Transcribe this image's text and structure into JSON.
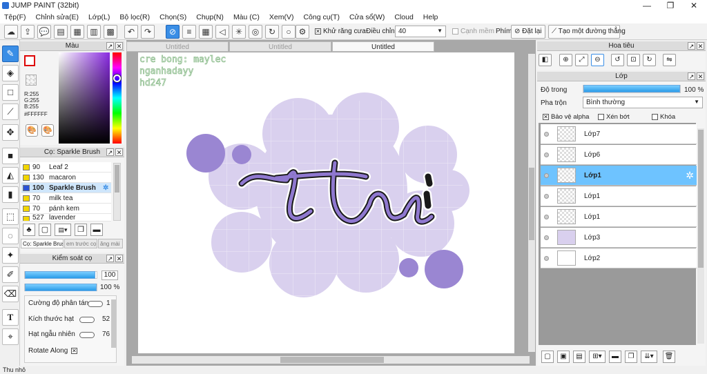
{
  "window": {
    "title": "JUMP PAINT (32bit)",
    "minimize": "—",
    "maximize": "❐",
    "close": "✕"
  },
  "menu": [
    "Tệp(F)",
    "Chỉnh sửa(E)",
    "Lớp(L)",
    "Bộ lọc(R)",
    "Chọn(S)",
    "Chụp(N)",
    "Màu (C)",
    "Xem(V)",
    "Công cụ(T)",
    "Cửa sổ(W)",
    "Cloud",
    "Help"
  ],
  "toolbar": {
    "antialias_label": "Khử răng cưa",
    "correction_label": "Điều chỉnh",
    "correction_value": "40",
    "edge_label": "Cạnh mềm",
    "key_label": "Phím",
    "reset_label": "Đặt lại",
    "straight_line_label": "Tạo một đường thẳng"
  },
  "color_panel": {
    "title": "Màu",
    "r": "R:255",
    "g": "G:255",
    "b": "B:255",
    "hex": "#FFFFFF"
  },
  "brush_panel": {
    "title": "Cọ: Sparkle Brush",
    "brushes": [
      {
        "size": "90",
        "name": "Leaf 2"
      },
      {
        "size": "130",
        "name": "macaron"
      },
      {
        "size": "100",
        "name": "Sparkle Brush"
      },
      {
        "size": "70",
        "name": "milk tea"
      },
      {
        "size": "70",
        "name": "pánh kem"
      },
      {
        "size": "527",
        "name": "lavender"
      }
    ],
    "tabs": [
      "Cọ: Sparkle Brush",
      "em trước cọ",
      "ăng mài"
    ]
  },
  "control_panel": {
    "title": "Kiểm soát cọ",
    "size_value": "100",
    "opacity_value": "100 %",
    "size_fill": 0.98,
    "opacity_fill": 1.0,
    "params": [
      {
        "label": "Cường độ phân tán",
        "value": "1"
      },
      {
        "label": "Kích thước hạt",
        "value": "52"
      },
      {
        "label": "Hạt ngẫu nhiên",
        "value": "76"
      },
      {
        "label": "Rotate Along",
        "value": "✕"
      }
    ]
  },
  "canvas": {
    "tabs": [
      "Untitled",
      "Untitled",
      "Untitled"
    ],
    "credit_lines": [
      "cre bong: maylec",
      "nganhadayy",
      "hd247"
    ],
    "lettering": "thai"
  },
  "navigator": {
    "title": "Hoa tiêu"
  },
  "layers": {
    "title": "Lớp",
    "opacity_label": "Độ trong",
    "opacity_value": "100 %",
    "opacity_fill": 1.0,
    "blend_label": "Pha trộn",
    "blend_value": "Bình thường",
    "protect_alpha_label": "Bảo vệ alpha",
    "clip_label": "Xén bớt",
    "lock_label": "Khóa",
    "list": [
      {
        "name": "Lớp7",
        "selected": false
      },
      {
        "name": "Lớp6",
        "selected": false
      },
      {
        "name": "Lớp1",
        "selected": true
      },
      {
        "name": "Lớp1",
        "selected": false
      },
      {
        "name": "Lớp1",
        "selected": false
      },
      {
        "name": "Lớp3",
        "selected": false
      },
      {
        "name": "Lớp2",
        "selected": false
      }
    ]
  },
  "status": {
    "text": "Thu nhỏ"
  },
  "colors": {
    "accent": "#3a8ee6",
    "selection": "#6ec3ff",
    "lavender": "#d9d0ee",
    "flower": "#9a86d2"
  }
}
